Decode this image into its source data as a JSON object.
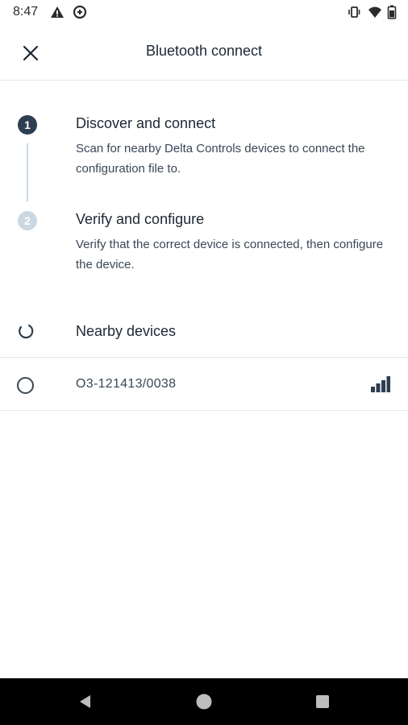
{
  "status_bar": {
    "time": "8:47",
    "left_icons": [
      "warning-icon",
      "data-saver-icon"
    ],
    "right_icons": [
      "vibrate-icon",
      "wifi-icon",
      "battery-icon"
    ]
  },
  "app_bar": {
    "close_icon": "close-icon",
    "title": "Bluetooth connect"
  },
  "steps": [
    {
      "number": "1",
      "title": "Discover and connect",
      "description": "Scan for nearby Delta Controls devices to connect the configuration file to.",
      "state": "active"
    },
    {
      "number": "2",
      "title": "Verify and configure",
      "description": "Verify that the correct device is connected, then configure the device.",
      "state": "inactive"
    }
  ],
  "nearby": {
    "label": "Nearby devices",
    "spinner_icon": "loading-spinner-icon"
  },
  "devices": [
    {
      "name": "O3-121413/0038",
      "selected": false,
      "signal_icon": "signal-strength-icon"
    }
  ],
  "nav_bar": {
    "buttons": [
      "back-icon",
      "home-icon",
      "recents-icon"
    ]
  },
  "colors": {
    "primary": "#2c3e50",
    "inactive_step": "#c9d8e3",
    "divider": "#e4e6e9",
    "text": "#1c2733",
    "secondary_text": "#3a4756"
  }
}
